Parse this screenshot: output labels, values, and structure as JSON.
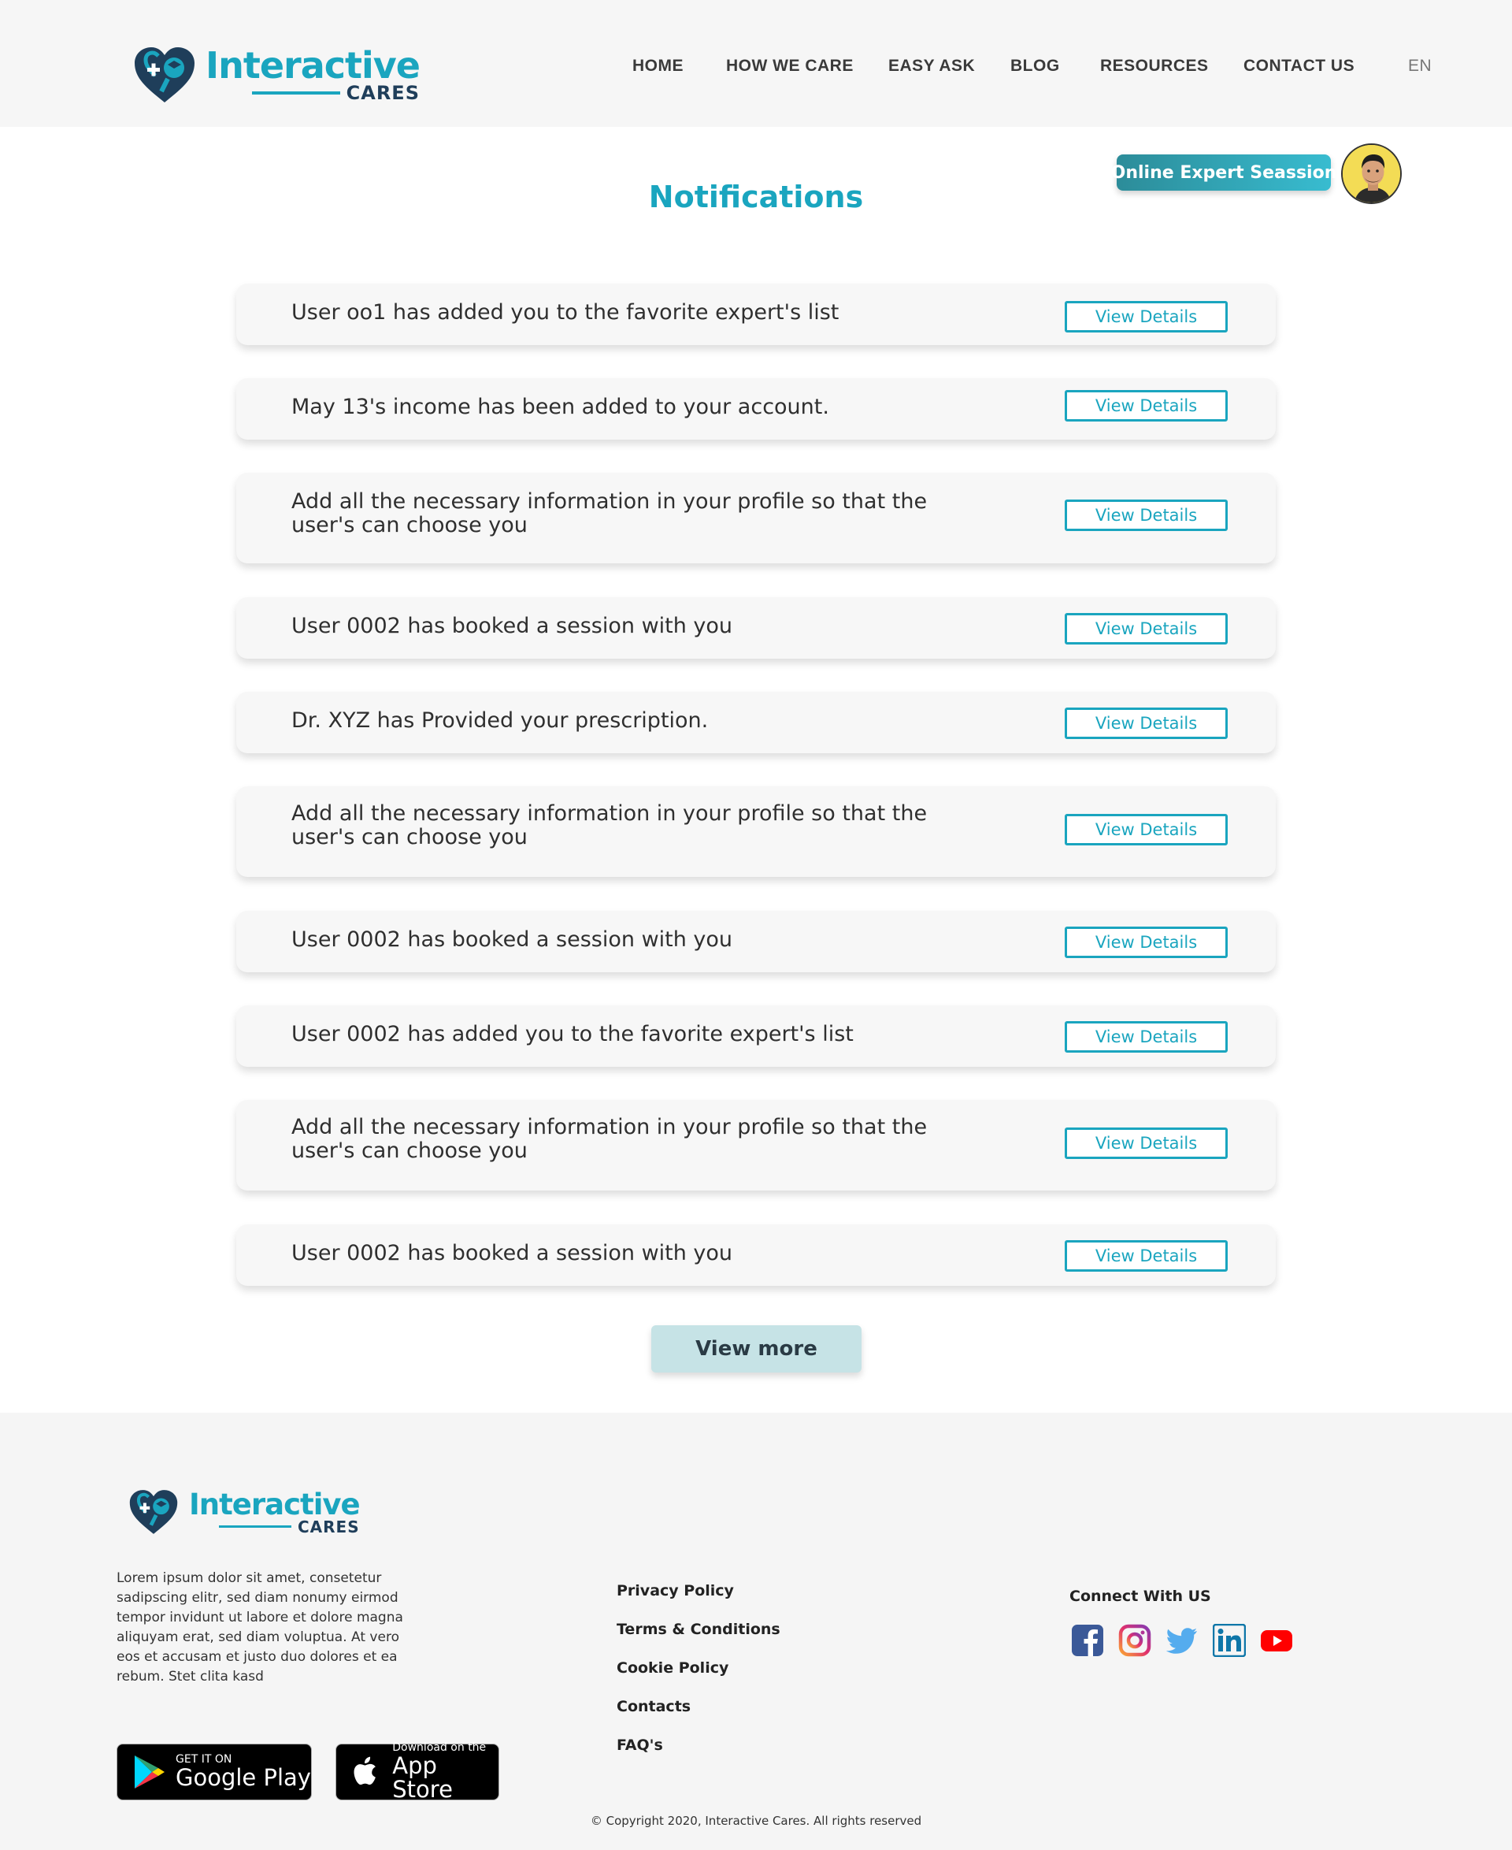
{
  "brand": {
    "title": "Interactive",
    "subtitle": "CARES",
    "colors": {
      "teal": "#1aa5bf",
      "navy": "#1f3e5a"
    }
  },
  "nav": {
    "items": [
      {
        "label": "HOME"
      },
      {
        "label": "HOW WE CARE"
      },
      {
        "label": "EASY ASK"
      },
      {
        "label": "BLOG"
      },
      {
        "label": "RESOURCES"
      },
      {
        "label": "CONTACT US"
      }
    ],
    "language": "EN"
  },
  "expert_session": {
    "label": "Online Expert Seassion"
  },
  "page": {
    "title": "Notifications"
  },
  "notifications": [
    {
      "text": "User oo1  has added you to the favorite expert's list",
      "action": "View Details"
    },
    {
      "text": "May 13's income has been added to your account.",
      "action": "View Details"
    },
    {
      "text": "Add all the necessary information in your profile so that the user's can choose you",
      "action": "View Details"
    },
    {
      "text": "User 0002 has booked a session with you",
      "action": "View Details"
    },
    {
      "text": "Dr. XYZ has Provided your prescription.",
      "action": "View Details"
    },
    {
      "text": "Add all the necessary information in your profile so that the user's can choose you",
      "action": "View Details"
    },
    {
      "text": "User 0002 has booked a session with you",
      "action": "View Details"
    },
    {
      "text": "User 0002 has added you to the favorite expert's list",
      "action": "View Details"
    },
    {
      "text": "Add all the necessary information in your profile so that the user's can choose you",
      "action": "View Details"
    },
    {
      "text": "User 0002 has booked a session with you",
      "action": "View Details"
    }
  ],
  "view_more": "View more",
  "footer": {
    "description": "Lorem ipsum dolor sit amet, consetetur sadipscing elitr, sed diam nonumy eirmod tempor invidunt ut labore et dolore magna aliquyam erat, sed diam voluptua. At vero eos et accusam et justo duo dolores et ea rebum. Stet clita kasd",
    "google_play": {
      "small": "GET IT ON",
      "big": "Google Play"
    },
    "app_store": {
      "small": "Download on the",
      "big": "App Store"
    },
    "links": [
      {
        "label": "Privacy Policy"
      },
      {
        "label": "Terms & Conditions"
      },
      {
        "label": "Cookie Policy"
      },
      {
        "label": "Contacts"
      },
      {
        "label": "FAQ's"
      }
    ],
    "connect_title": "Connect With US",
    "social": [
      "facebook-icon",
      "instagram-icon",
      "twitter-icon",
      "linkedin-icon",
      "youtube-icon"
    ],
    "copyright": "© Copyright 2020, Interactive Cares. All rights reserved"
  }
}
